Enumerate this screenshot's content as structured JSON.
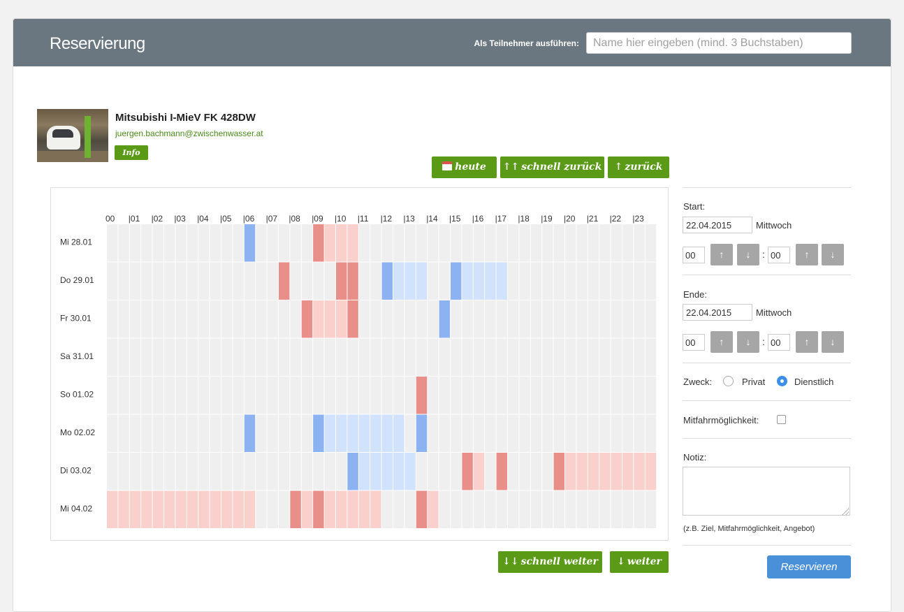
{
  "header": {
    "title": "Reservierung",
    "participant_label": "Als Teilnehmer ausführen:",
    "participant_placeholder": "Name hier eingeben (mind. 3 Buchstaben)"
  },
  "vehicle": {
    "name": "Mitsubishi I-MieV FK 428DW",
    "email": "juergen.bachmann@zwischenwasser.at",
    "info_label": "Info",
    "photo_icon": "car-photo"
  },
  "nav": {
    "today": "heute",
    "fast_back": "schnell zurück",
    "back": "zurück",
    "fast_forward": "schnell weiter",
    "forward": "weiter",
    "today_icon": "calendar-icon",
    "up_arrow": "↑",
    "double_up_arrow": "↑↑",
    "down_arrow": "↓",
    "double_down_arrow": "↓↓"
  },
  "schedule": {
    "hour_labels": [
      "00",
      "|01",
      "|02",
      "|03",
      "|04",
      "|05",
      "|06",
      "|07",
      "|08",
      "|09",
      "|10",
      "|11",
      "|12",
      "|13",
      "|14",
      "|15",
      "|16",
      "|17",
      "|18",
      "|19",
      "|20",
      "|21",
      "|22",
      "|23"
    ],
    "slots_per_hour": 2,
    "legend_colors": {
      "empty": "#efefef",
      "blue_start": "#8cb2f2",
      "blue_fill": "#d1e2fc",
      "red_start": "#e88f8a",
      "red_fill": "#fad0cd"
    },
    "days": [
      {
        "label": "Mi 28.01",
        "blocks": [
          {
            "type": "blue",
            "start": 12,
            "end": 13
          },
          {
            "type": "red",
            "start": 18,
            "end": 22
          }
        ]
      },
      {
        "label": "Do 29.01",
        "blocks": [
          {
            "type": "red",
            "start": 15,
            "end": 16
          },
          {
            "type": "red",
            "start": 20,
            "end": 21
          },
          {
            "type": "red",
            "start": 21,
            "end": 22
          },
          {
            "type": "blue",
            "start": 24,
            "end": 28
          },
          {
            "type": "blue",
            "start": 30,
            "end": 35
          }
        ]
      },
      {
        "label": "Fr 30.01",
        "blocks": [
          {
            "type": "red",
            "start": 17,
            "end": 21
          },
          {
            "type": "red",
            "start": 21,
            "end": 22
          },
          {
            "type": "blue",
            "start": 29,
            "end": 30
          }
        ]
      },
      {
        "label": "Sa 31.01",
        "blocks": []
      },
      {
        "label": "So 01.02",
        "blocks": [
          {
            "type": "red",
            "start": 27,
            "end": 28
          }
        ]
      },
      {
        "label": "Mo 02.02",
        "blocks": [
          {
            "type": "blue",
            "start": 12,
            "end": 13
          },
          {
            "type": "blue",
            "start": 18,
            "end": 26
          },
          {
            "type": "blue",
            "start": 27,
            "end": 28
          }
        ]
      },
      {
        "label": "Di 03.02",
        "blocks": [
          {
            "type": "blue",
            "start": 21,
            "end": 27
          },
          {
            "type": "red",
            "start": 31,
            "end": 33
          },
          {
            "type": "red",
            "start": 34,
            "end": 35
          },
          {
            "type": "red",
            "start": 39,
            "end": 48
          }
        ]
      },
      {
        "label": "Mi 04.02",
        "blocks": [
          {
            "type": "redfill",
            "start": 0,
            "end": 13
          },
          {
            "type": "red",
            "start": 16,
            "end": 18
          },
          {
            "type": "red",
            "start": 18,
            "end": 24
          },
          {
            "type": "red",
            "start": 27,
            "end": 29
          }
        ]
      }
    ]
  },
  "form": {
    "start_label": "Start:",
    "start_date": "22.04.2015",
    "start_weekday": "Mittwoch",
    "start_hour": "00",
    "start_minute": "00",
    "end_label": "Ende:",
    "end_date": "22.04.2015",
    "end_weekday": "Mittwoch",
    "end_hour": "00",
    "end_minute": "00",
    "colon": ":",
    "purpose_label": "Zweck:",
    "purpose_private": "Privat",
    "purpose_business": "Dienstlich",
    "purpose_selected": "Dienstlich",
    "carpool_label": "Mitfahrmöglichkeit:",
    "carpool_checked": false,
    "note_label": "Notiz:",
    "note_value": "",
    "note_hint": "(z.B. Ziel, Mitfahrmöglichkeit, Angebot)",
    "submit_label": "Reservieren",
    "up_arrow": "↑",
    "down_arrow": "↓"
  }
}
